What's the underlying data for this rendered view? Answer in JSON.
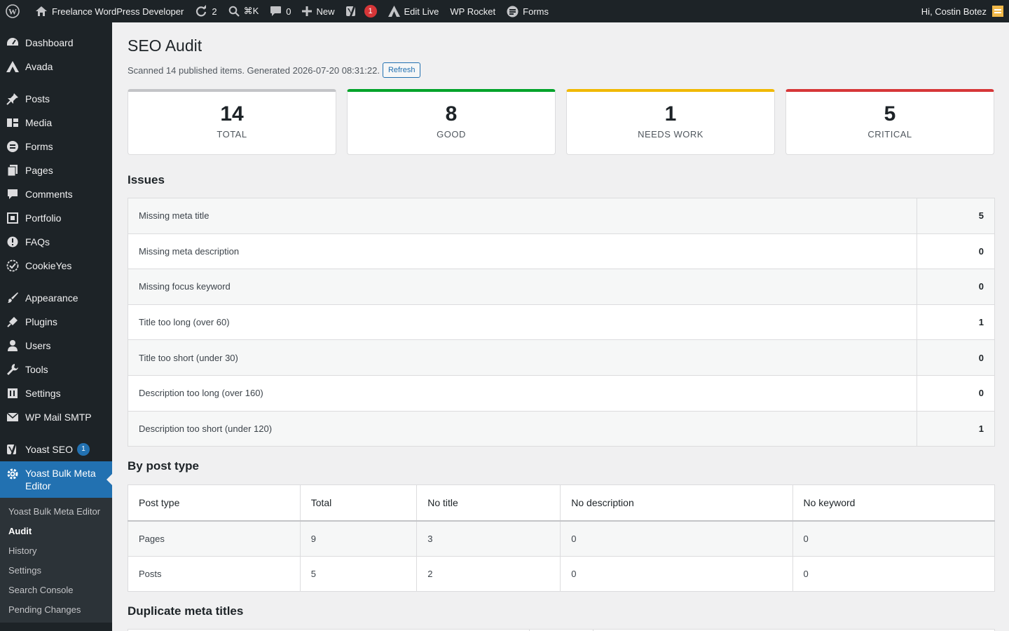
{
  "adminbar": {
    "site_name": "Freelance WordPress Developer",
    "updates_count": "2",
    "search_shortcut": "⌘K",
    "comments_count": "0",
    "new_label": "New",
    "yoast_badge": "1",
    "edit_live_label": "Edit Live",
    "wp_rocket_label": "WP Rocket",
    "forms_label": "Forms",
    "greeting": "Hi, Costin Botez"
  },
  "sidebar": {
    "items": [
      {
        "label": "Dashboard",
        "icon": "dashboard-icon"
      },
      {
        "label": "Avada",
        "icon": "avada-icon"
      },
      {
        "label": "Posts",
        "icon": "pin-icon"
      },
      {
        "label": "Media",
        "icon": "media-icon"
      },
      {
        "label": "Forms",
        "icon": "forms-icon"
      },
      {
        "label": "Pages",
        "icon": "pages-icon"
      },
      {
        "label": "Comments",
        "icon": "comment-icon"
      },
      {
        "label": "Portfolio",
        "icon": "portfolio-icon"
      },
      {
        "label": "FAQs",
        "icon": "faq-icon"
      },
      {
        "label": "CookieYes",
        "icon": "cookie-icon"
      },
      {
        "label": "Appearance",
        "icon": "brush-icon"
      },
      {
        "label": "Plugins",
        "icon": "plug-icon"
      },
      {
        "label": "Users",
        "icon": "user-icon"
      },
      {
        "label": "Tools",
        "icon": "wrench-icon"
      },
      {
        "label": "Settings",
        "icon": "settings-icon"
      },
      {
        "label": "WP Mail SMTP",
        "icon": "mail-icon"
      },
      {
        "label": "Yoast SEO",
        "icon": "yoast-icon",
        "badge": "1"
      },
      {
        "label": "Yoast Bulk Meta Editor",
        "icon": "gear-icon"
      }
    ],
    "submenu": [
      "Yoast Bulk Meta Editor",
      "Audit",
      "History",
      "Settings",
      "Search Console",
      "Pending Changes"
    ]
  },
  "page": {
    "title": "SEO Audit",
    "meta": "Scanned 14 published items. Generated 2026-07-20 08:31:22.",
    "refresh_label": "Refresh"
  },
  "cards": [
    {
      "value": "14",
      "label": "TOTAL",
      "color": "#c3c4c7"
    },
    {
      "value": "8",
      "label": "GOOD",
      "color": "#00a32a"
    },
    {
      "value": "1",
      "label": "NEEDS WORK",
      "color": "#f0b800"
    },
    {
      "value": "5",
      "label": "CRITICAL",
      "color": "#d63638"
    }
  ],
  "issues": {
    "title": "Issues",
    "rows": [
      {
        "label": "Missing meta title",
        "count": "5"
      },
      {
        "label": "Missing meta description",
        "count": "0"
      },
      {
        "label": "Missing focus keyword",
        "count": "0"
      },
      {
        "label": "Title too long (over 60)",
        "count": "1"
      },
      {
        "label": "Title too short (under 30)",
        "count": "0"
      },
      {
        "label": "Description too long (over 160)",
        "count": "0"
      },
      {
        "label": "Description too short (under 120)",
        "count": "1"
      }
    ]
  },
  "by_post_type": {
    "title": "By post type",
    "headers": [
      "Post type",
      "Total",
      "No title",
      "No description",
      "No keyword"
    ],
    "rows": [
      [
        "Pages",
        "9",
        "3",
        "0",
        "0"
      ],
      [
        "Posts",
        "5",
        "2",
        "0",
        "0"
      ]
    ]
  },
  "duplicates": {
    "title": "Duplicate meta titles"
  }
}
